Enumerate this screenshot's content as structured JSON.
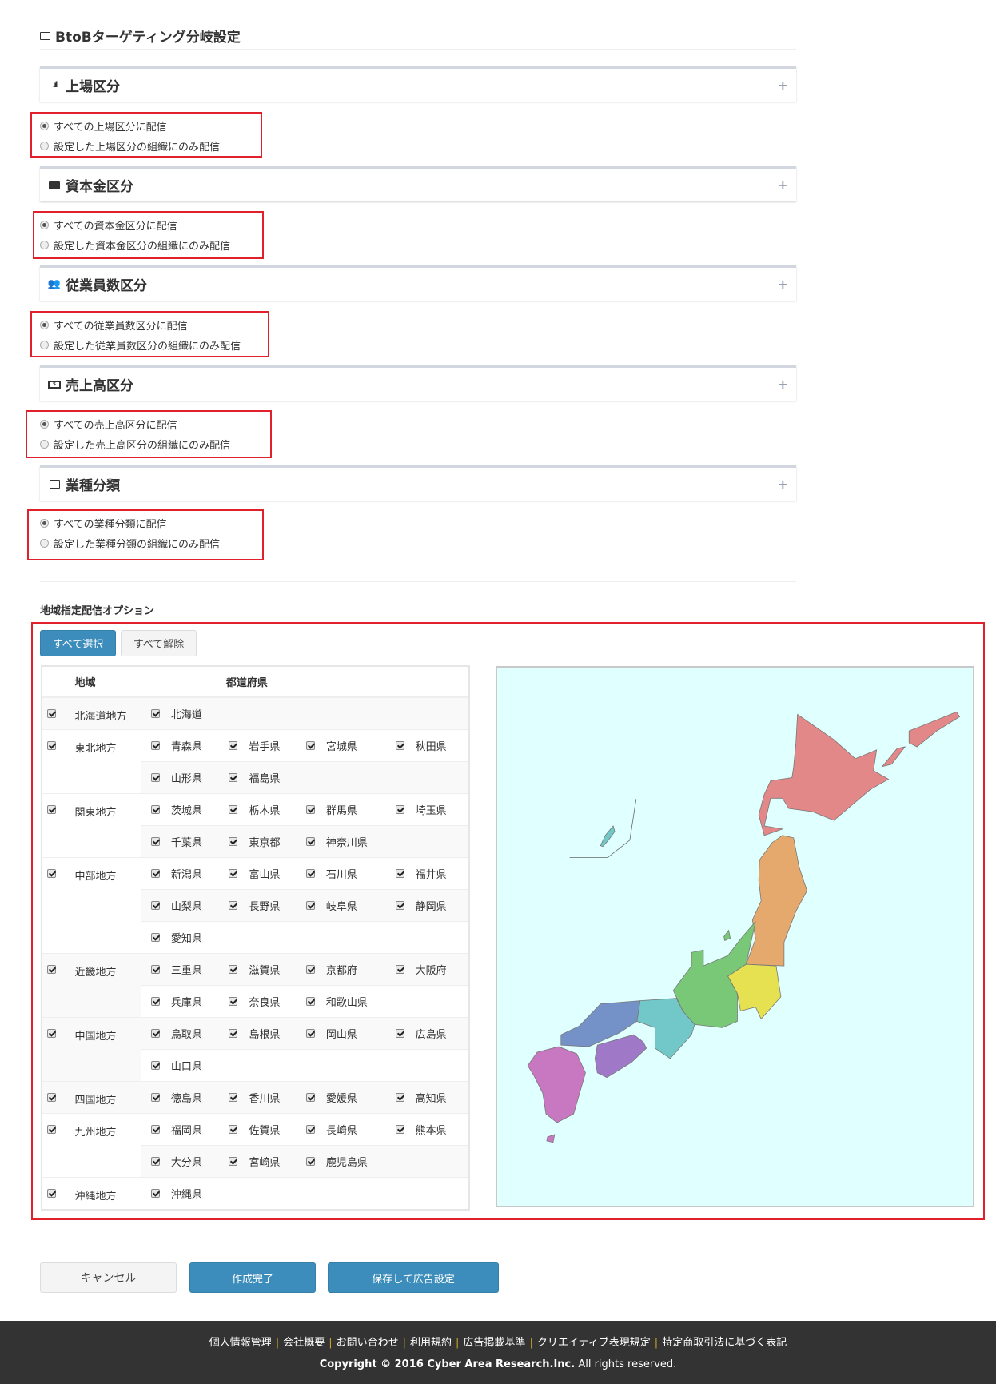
{
  "page": {
    "title": "BtoBターゲティング分岐設定"
  },
  "sections": [
    {
      "title": "上場区分",
      "icon": "signal-icon",
      "options": [
        "すべての上場区分に配信",
        "設定した上場区分の組織にのみ配信"
      ],
      "selected": 0
    },
    {
      "title": "資本金区分",
      "icon": "briefcase-icon",
      "options": [
        "すべての資本金区分に配信",
        "設定した資本金区分の組織にのみ配信"
      ],
      "selected": 0
    },
    {
      "title": "従業員数区分",
      "icon": "users-icon",
      "options": [
        "すべての従業員数区分に配信",
        "設定した従業員数区分の組織にのみ配信"
      ],
      "selected": 0
    },
    {
      "title": "売上高区分",
      "icon": "money-icon",
      "options": [
        "すべての売上高区分に配信",
        "設定した売上高区分の組織にのみ配信"
      ],
      "selected": 0
    },
    {
      "title": "業種分類",
      "icon": "shopping-bag-icon",
      "options": [
        "すべての業種分類に配信",
        "設定した業種分類の組織にのみ配信"
      ],
      "selected": 0
    }
  ],
  "expand_symbol": "+",
  "region": {
    "heading": "地域指定配信オプション",
    "select_all": "すべて選択",
    "deselect_all": "すべて解除",
    "col_region": "地域",
    "col_pref": "都道府県",
    "regions": [
      {
        "name": "北海道地方",
        "checked": true,
        "prefs": [
          "北海道"
        ]
      },
      {
        "name": "東北地方",
        "checked": true,
        "prefs": [
          "青森県",
          "岩手県",
          "宮城県",
          "秋田県",
          "山形県",
          "福島県"
        ]
      },
      {
        "name": "関東地方",
        "checked": true,
        "prefs": [
          "茨城県",
          "栃木県",
          "群馬県",
          "埼玉県",
          "千葉県",
          "東京都",
          "神奈川県"
        ]
      },
      {
        "name": "中部地方",
        "checked": true,
        "prefs": [
          "新潟県",
          "富山県",
          "石川県",
          "福井県",
          "山梨県",
          "長野県",
          "岐阜県",
          "静岡県",
          "愛知県"
        ]
      },
      {
        "name": "近畿地方",
        "checked": true,
        "prefs": [
          "三重県",
          "滋賀県",
          "京都府",
          "大阪府",
          "兵庫県",
          "奈良県",
          "和歌山県"
        ]
      },
      {
        "name": "中国地方",
        "checked": true,
        "prefs": [
          "鳥取県",
          "島根県",
          "岡山県",
          "広島県",
          "山口県"
        ]
      },
      {
        "name": "四国地方",
        "checked": true,
        "prefs": [
          "徳島県",
          "香川県",
          "愛媛県",
          "高知県"
        ]
      },
      {
        "name": "九州地方",
        "checked": true,
        "prefs": [
          "福岡県",
          "佐賀県",
          "長崎県",
          "熊本県",
          "大分県",
          "宮崎県",
          "鹿児島県"
        ]
      },
      {
        "name": "沖縄地方",
        "checked": true,
        "prefs": [
          "沖縄県"
        ]
      }
    ],
    "map_colors": {
      "hokkaido": "#e38888",
      "tohoku": "#e5a96e",
      "kanto": "#e6e150",
      "chubu": "#78c878",
      "kinki": "#72c8c8",
      "chugoku": "#7592c8",
      "shikoku": "#a078c8",
      "kyushu": "#c878c0",
      "okinawa": "#72c8c8",
      "sea": "#e0ffff"
    }
  },
  "actions": {
    "cancel": "キャンセル",
    "complete": "作成完了",
    "save_ad": "保存して広告設定"
  },
  "footer": {
    "links": [
      "個人情報管理",
      "会社概要",
      "お問い合わせ",
      "利用規約",
      "広告掲載基準",
      "クリエイティブ表現規定",
      "特定商取引法に基づく表記"
    ],
    "copyright_bold": "Copyright © 2016 Cyber Area Research.Inc.",
    "copyright_rest": " All rights reserved."
  }
}
